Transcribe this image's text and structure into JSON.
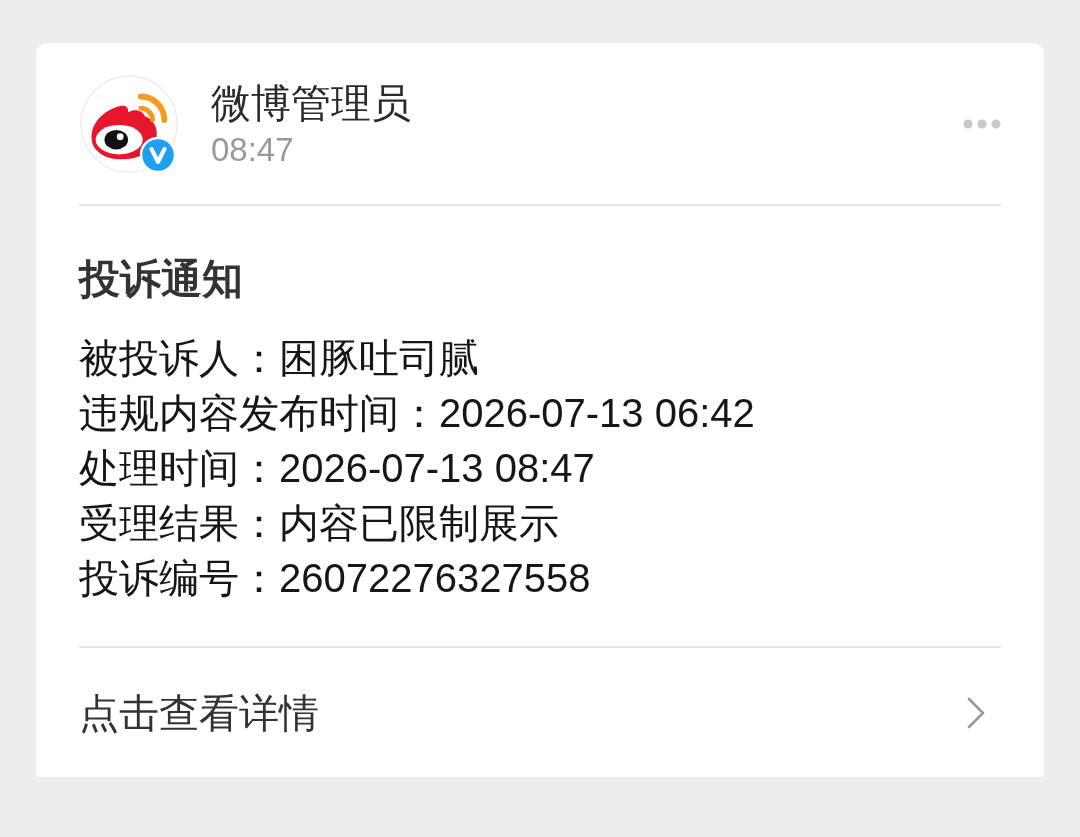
{
  "header": {
    "sender": "微博管理员",
    "time": "08:47",
    "verified": true
  },
  "notice": {
    "title": "投诉通知",
    "details": [
      {
        "label": "被投诉人：",
        "value": "困豚吐司腻"
      },
      {
        "label": "违规内容发布时间：",
        "value": "2026-07-13 06:42"
      },
      {
        "label": "处理时间：",
        "value": "2026-07-13 08:47"
      },
      {
        "label": "受理结果：",
        "value": "内容已限制展示"
      },
      {
        "label": "投诉编号：",
        "value": "26072276327558"
      }
    ]
  },
  "footer": {
    "link": "点击查看详情"
  }
}
